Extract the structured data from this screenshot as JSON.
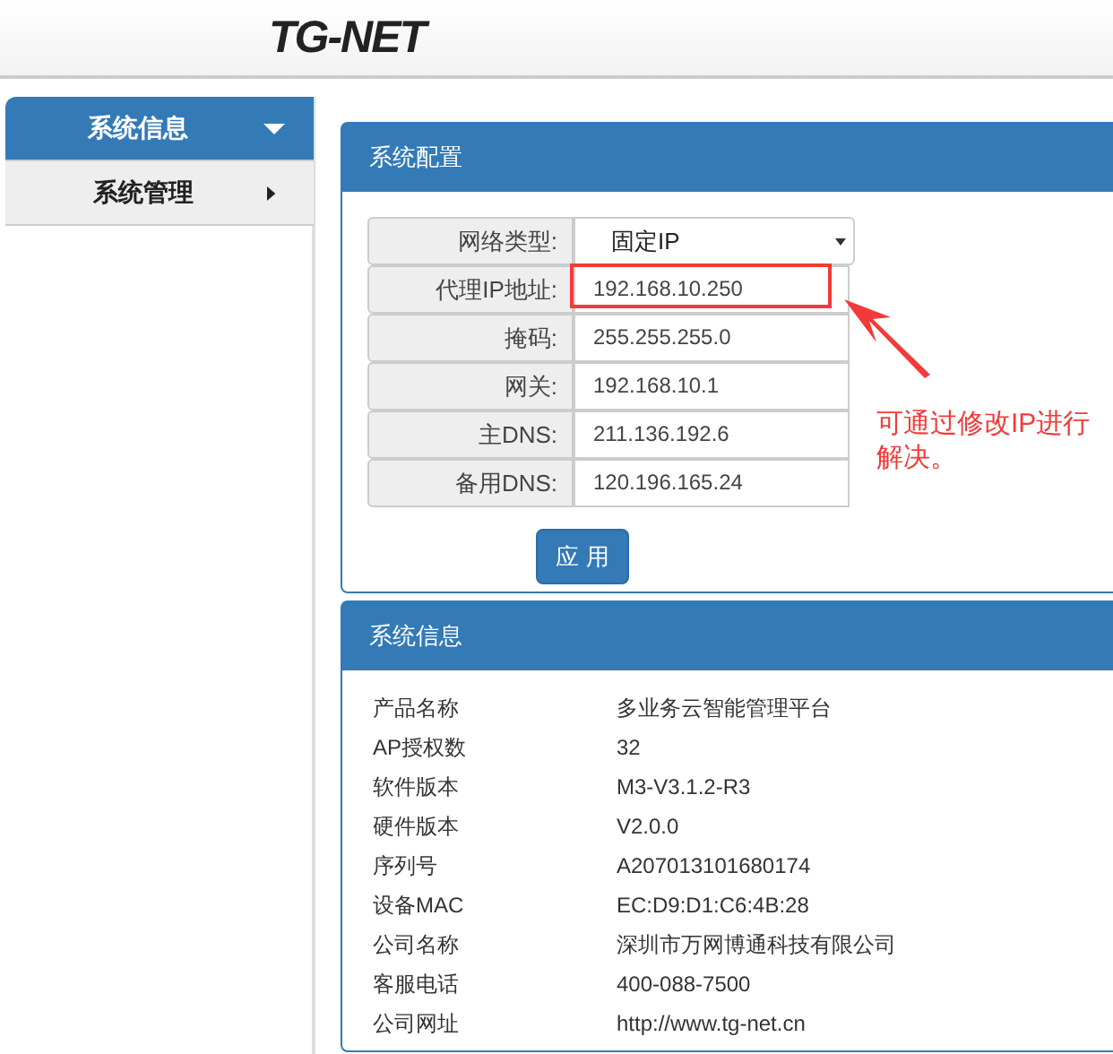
{
  "header": {
    "logo": "TG-NET"
  },
  "sidebar": {
    "items": [
      {
        "label": "系统信息",
        "selected": true,
        "expanded": true
      },
      {
        "label": "系统管理",
        "selected": false,
        "expanded": false
      }
    ]
  },
  "config_panel": {
    "title": "系统配置",
    "network_type": {
      "label": "网络类型:",
      "value": "固定IP"
    },
    "fields": [
      {
        "label": "代理IP地址:",
        "value": "192.168.10.250",
        "highlighted": true
      },
      {
        "label": "掩码:",
        "value": "255.255.255.0",
        "highlighted": false
      },
      {
        "label": "网关:",
        "value": "192.168.10.1",
        "highlighted": false
      },
      {
        "label": "主DNS:",
        "value": "211.136.192.6",
        "highlighted": false
      },
      {
        "label": "备用DNS:",
        "value": "120.196.165.24",
        "highlighted": false
      }
    ],
    "apply_button": "应 用"
  },
  "annotation": {
    "text": "可通过修改IP进行解决。"
  },
  "info_panel": {
    "title": "系统信息",
    "rows": [
      {
        "label": "产品名称",
        "value": "多业务云智能管理平台"
      },
      {
        "label": "AP授权数",
        "value": "32"
      },
      {
        "label": "软件版本",
        "value": "M3-V3.1.2-R3"
      },
      {
        "label": "硬件版本",
        "value": "V2.0.0"
      },
      {
        "label": "序列号",
        "value": "A207013101680174"
      },
      {
        "label": "设备MAC",
        "value": "EC:D9:D1:C6:4B:28"
      },
      {
        "label": "公司名称",
        "value": "深圳市万网博通科技有限公司"
      },
      {
        "label": "客服电话",
        "value": "400-088-7500"
      },
      {
        "label": "公司网址",
        "value": "http://www.tg-net.cn"
      }
    ]
  }
}
